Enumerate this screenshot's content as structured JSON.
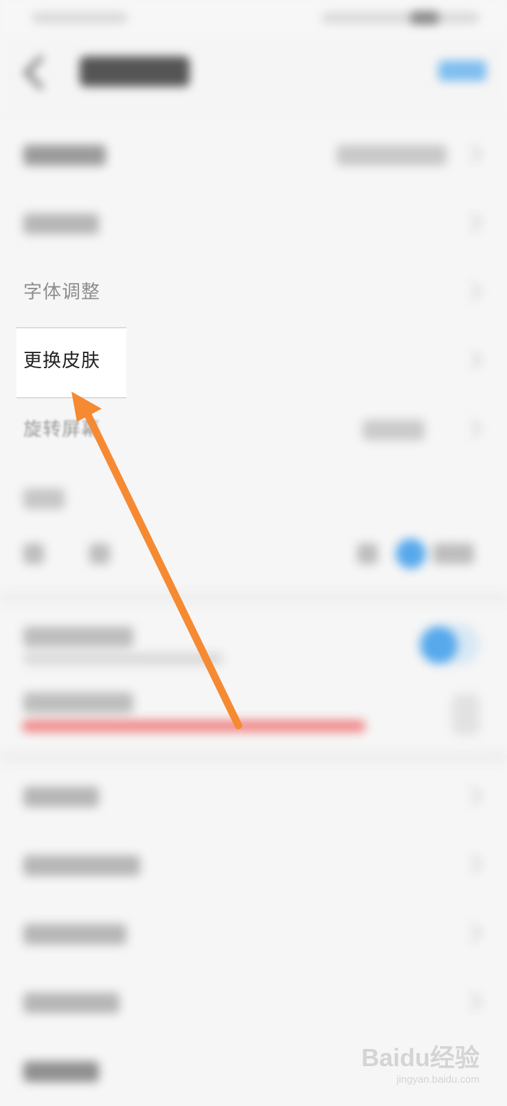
{
  "settings": {
    "items": [
      {
        "label": "字体调整"
      },
      {
        "label": "更换皮肤"
      },
      {
        "label": "旋转屏幕"
      }
    ]
  },
  "annotation": {
    "arrow_color": "#f58a33"
  },
  "watermark": {
    "logo": "Baidu经验",
    "url": "jingyan.baidu.com"
  },
  "colors": {
    "accent": "#57a9ec",
    "warning_text": "#e05a5a"
  }
}
